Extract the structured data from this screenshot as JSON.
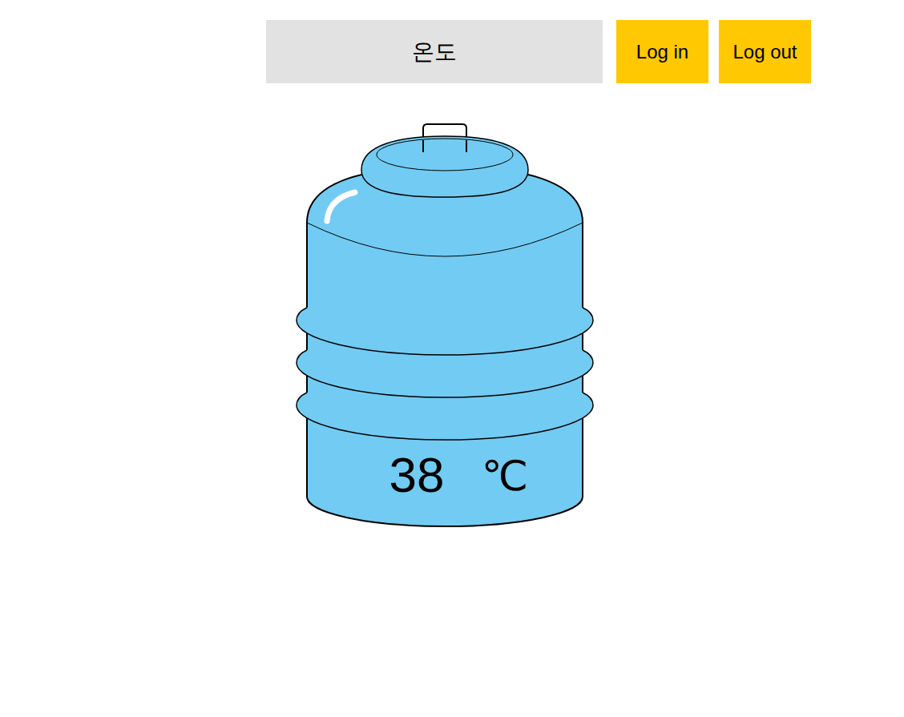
{
  "header": {
    "title": "온도"
  },
  "buttons": [
    {
      "label": "Log in"
    },
    {
      "label": "Log out"
    }
  ],
  "tank": {
    "value": "38",
    "unit": "℃"
  }
}
